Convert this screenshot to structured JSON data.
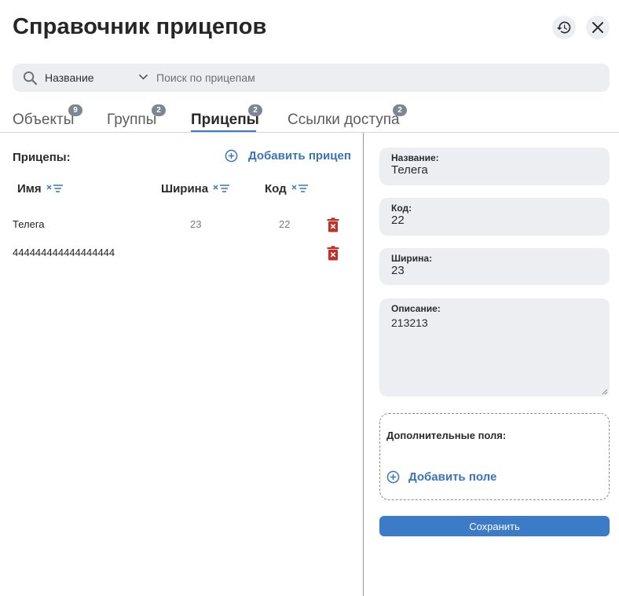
{
  "header": {
    "title": "Справочник прицепов"
  },
  "search": {
    "field_selected": "Название",
    "placeholder": "Поиск по прицепам"
  },
  "tabs": [
    {
      "label": "Объекты",
      "count": "9",
      "active": false
    },
    {
      "label": "Группы",
      "count": "2",
      "active": false
    },
    {
      "label": "Прицепы",
      "count": "2",
      "active": true
    },
    {
      "label": "Ссылки доступа",
      "count": "2",
      "active": false
    }
  ],
  "list": {
    "title": "Прицепы:",
    "add_label": "Добавить прицеп",
    "columns": {
      "name": "Имя",
      "width": "Ширина",
      "code": "Код"
    },
    "rows": [
      {
        "name": "Телега",
        "width": "23",
        "code": "22"
      },
      {
        "name": "444444444444444444",
        "width": "",
        "code": ""
      }
    ]
  },
  "form": {
    "name": {
      "label": "Название:",
      "value": "Телега"
    },
    "code": {
      "label": "Код:",
      "value": "22"
    },
    "width": {
      "label": "Ширина:",
      "value": "23"
    },
    "description": {
      "label": "Описание:",
      "value": "213213"
    },
    "extra_fields_label": "Дополнительные поля:",
    "add_field_label": "Добавить поле",
    "save_label": "Сохранить"
  },
  "colors": {
    "accent": "#3b7bc8",
    "link": "#3b73b9",
    "danger": "#c0302b",
    "field_bg": "#eceef2",
    "badge": "#7f8690"
  }
}
